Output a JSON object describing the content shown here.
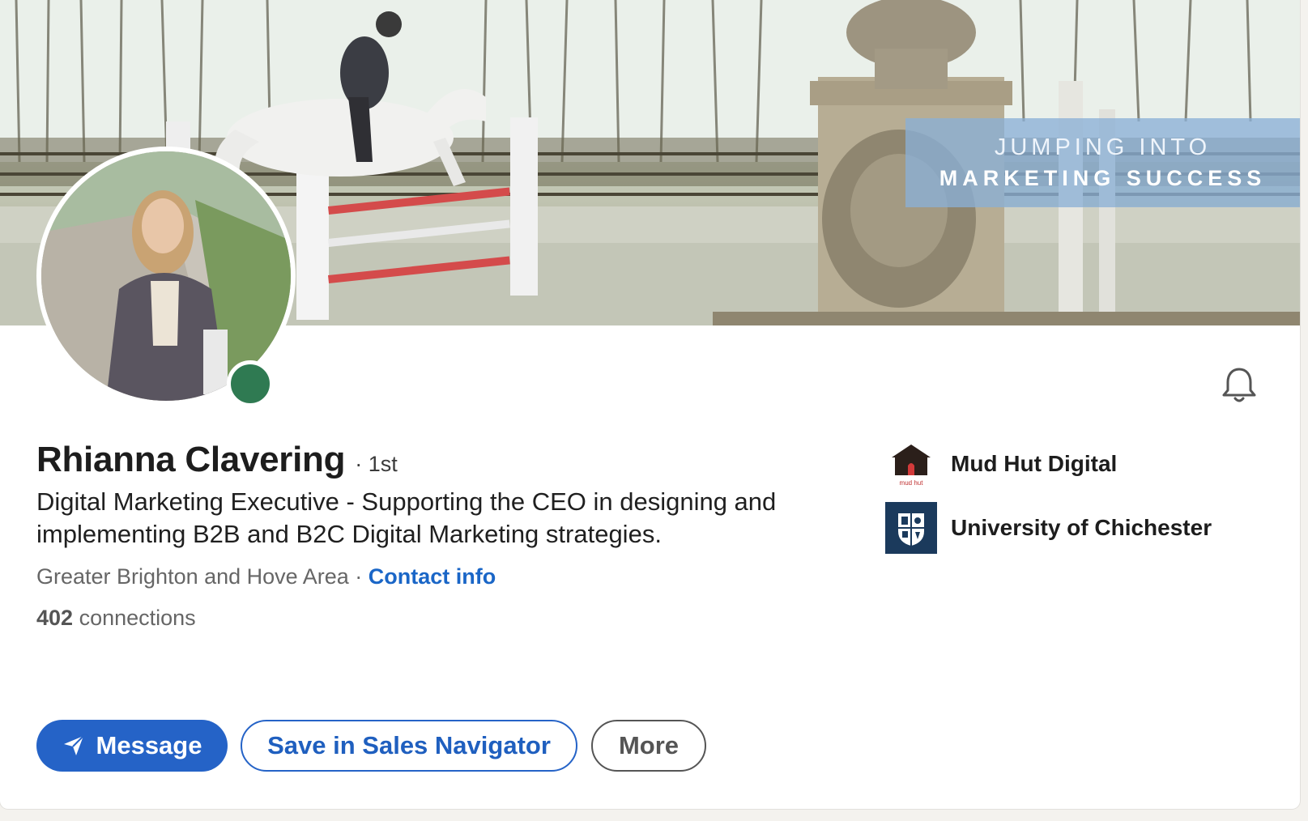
{
  "banner": {
    "line1": "JUMPING INTO",
    "line2": "MARKETING SUCCESS"
  },
  "profile": {
    "name": "Rhianna Clavering",
    "degree": "· 1st",
    "headline": "Digital Marketing Executive - Supporting the CEO in designing and implementing B2B and B2C Digital Marketing strategies.",
    "location": "Greater Brighton and Hove Area",
    "separator": " · ",
    "contact_label": "Contact info",
    "connections_count": "402",
    "connections_label": " connections"
  },
  "orgs": [
    {
      "name": "Mud Hut Digital",
      "logo_text": "mud hut",
      "icon": "mud-hut-logo"
    },
    {
      "name": "University of Chichester",
      "icon": "university-crest-logo"
    }
  ],
  "actions": {
    "message_label": "Message",
    "save_label": "Save in Sales Navigator",
    "more_label": "More"
  },
  "colors": {
    "primary": "#2563c7",
    "presence": "#2f7a52",
    "banner_box": "#8ab0d6",
    "university_navy": "#1b3a5c"
  },
  "icons": [
    "send-icon",
    "bell-icon"
  ]
}
